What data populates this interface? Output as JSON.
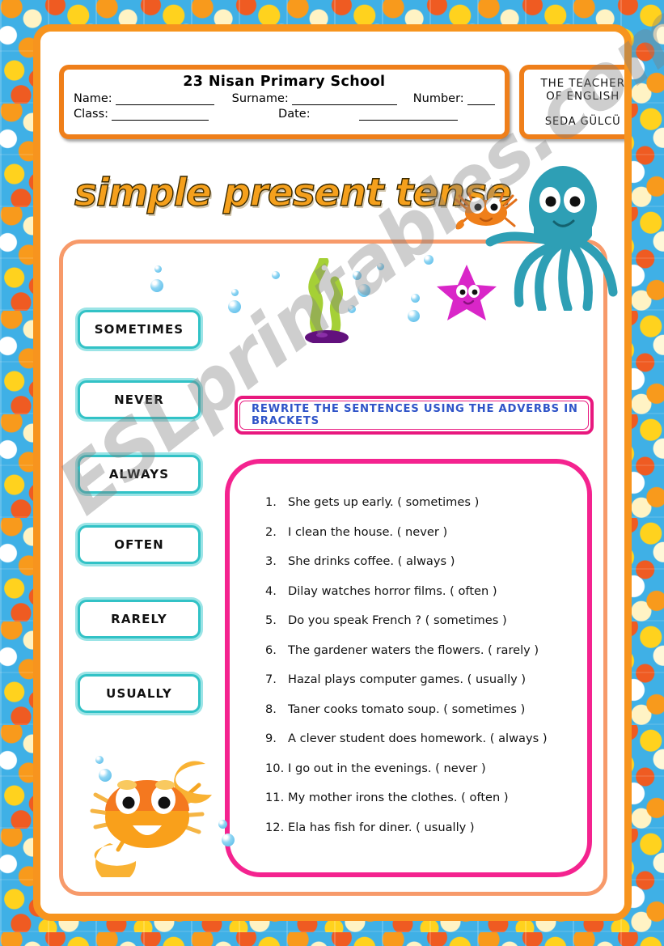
{
  "header": {
    "school_name": "23 Nisan Primary School",
    "fields": {
      "name_label": "Name:",
      "surname_label": "Surname:",
      "number_label": "Number:",
      "class_label": "Class:",
      "date_label": "Date:",
      "name_value": "",
      "surname_value": "",
      "number_value": "",
      "class_value": "",
      "date_value": ""
    },
    "teacher": {
      "line1": "THE TEACHER",
      "line2": "OF ENGLISH",
      "name": "SEDA GÜLCÜ"
    }
  },
  "title": "simple present tense",
  "adverbs": [
    {
      "label": "SOMETIMES"
    },
    {
      "label": "NEVER"
    },
    {
      "label": "ALWAYS"
    },
    {
      "label": "OFTEN"
    },
    {
      "label": "RARELY"
    },
    {
      "label": "USUALLY"
    }
  ],
  "instruction": "REWRITE THE SENTENCES USING THE ADVERBS IN BRACKETS",
  "exercises": [
    {
      "num": "1.",
      "text": "She gets up early. ( sometimes )"
    },
    {
      "num": "2.",
      "text": "I clean the house. ( never )"
    },
    {
      "num": "3.",
      "text": "She drinks coffee. ( always )"
    },
    {
      "num": "4.",
      "text": "Dilay watches horror films. ( often )"
    },
    {
      "num": "5.",
      "text": "Do you speak French ? ( sometimes )"
    },
    {
      "num": "6.",
      "text": "The gardener waters the flowers. ( rarely )"
    },
    {
      "num": "7.",
      "text": "Hazal plays computer games. ( usually )"
    },
    {
      "num": "8.",
      "text": "Taner cooks tomato soup. ( sometimes )"
    },
    {
      "num": "9.",
      "text": "A clever student does homework. ( always )"
    },
    {
      "num": "10.",
      "text": "I go out in the evenings. ( never )"
    },
    {
      "num": "11.",
      "text": "My mother irons the clothes. ( often )"
    },
    {
      "num": "12.",
      "text": "Ela has fish for diner. ( usually )"
    }
  ],
  "watermark": "ESLprintables.com",
  "colors": {
    "frame_orange": "#f7941e",
    "panel_salmon": "#f79a6a",
    "adverb_teal": "#32c2c6",
    "pink": "#f4238f",
    "magenta": "#e8187e",
    "instruction_blue": "#2f54c8",
    "title_orange": "#f5a01c",
    "border_blue": "#3fb0e6"
  },
  "decorations": {
    "octopus": "octopus-illustration",
    "small_crab": "crab-illustration",
    "big_crab": "crab-illustration",
    "starfish": "starfish-illustration",
    "seaweed": "seaweed-illustration",
    "bubbles": "bubble-icon"
  }
}
